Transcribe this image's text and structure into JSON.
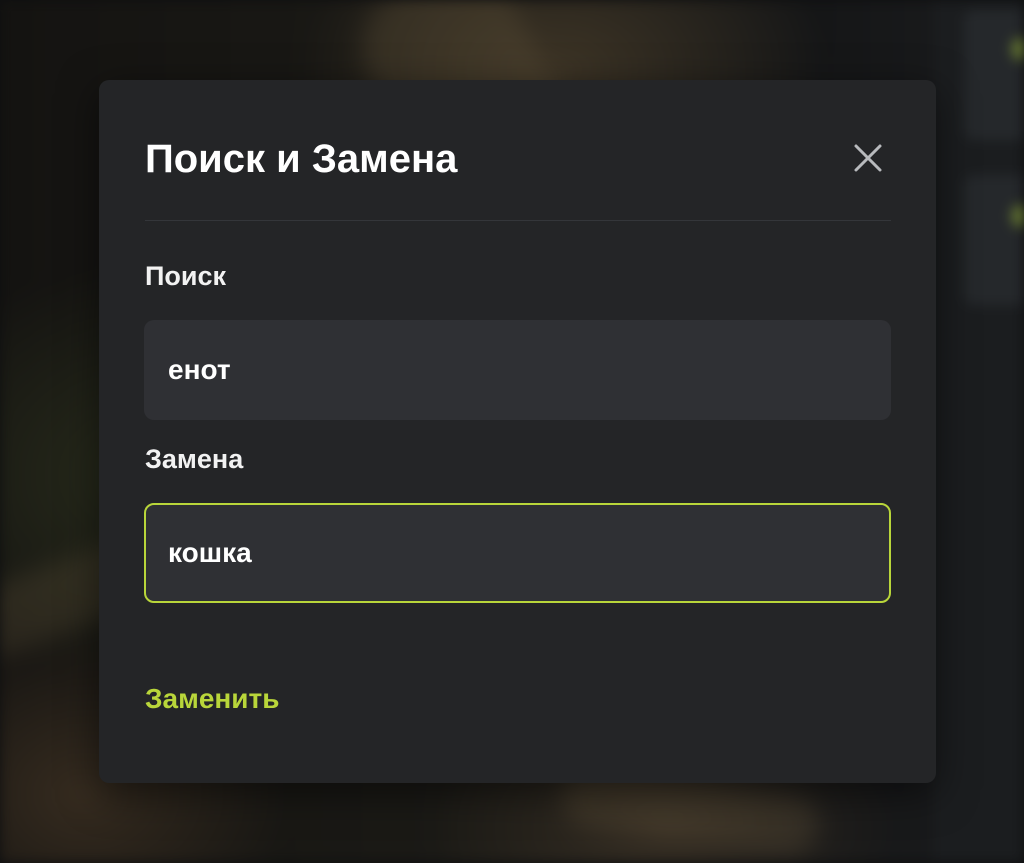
{
  "dialog": {
    "title": "Поиск и Замена",
    "close_icon": "close-icon",
    "search": {
      "label": "Поиск",
      "value": "енот"
    },
    "replace": {
      "label": "Замена",
      "value": "кошка",
      "focused": true
    },
    "replace_button_label": "Заменить"
  },
  "colors": {
    "accent": "#b9d63a",
    "dialog_background": "#242527",
    "input_background": "#2f3034",
    "text": "#ffffff"
  }
}
